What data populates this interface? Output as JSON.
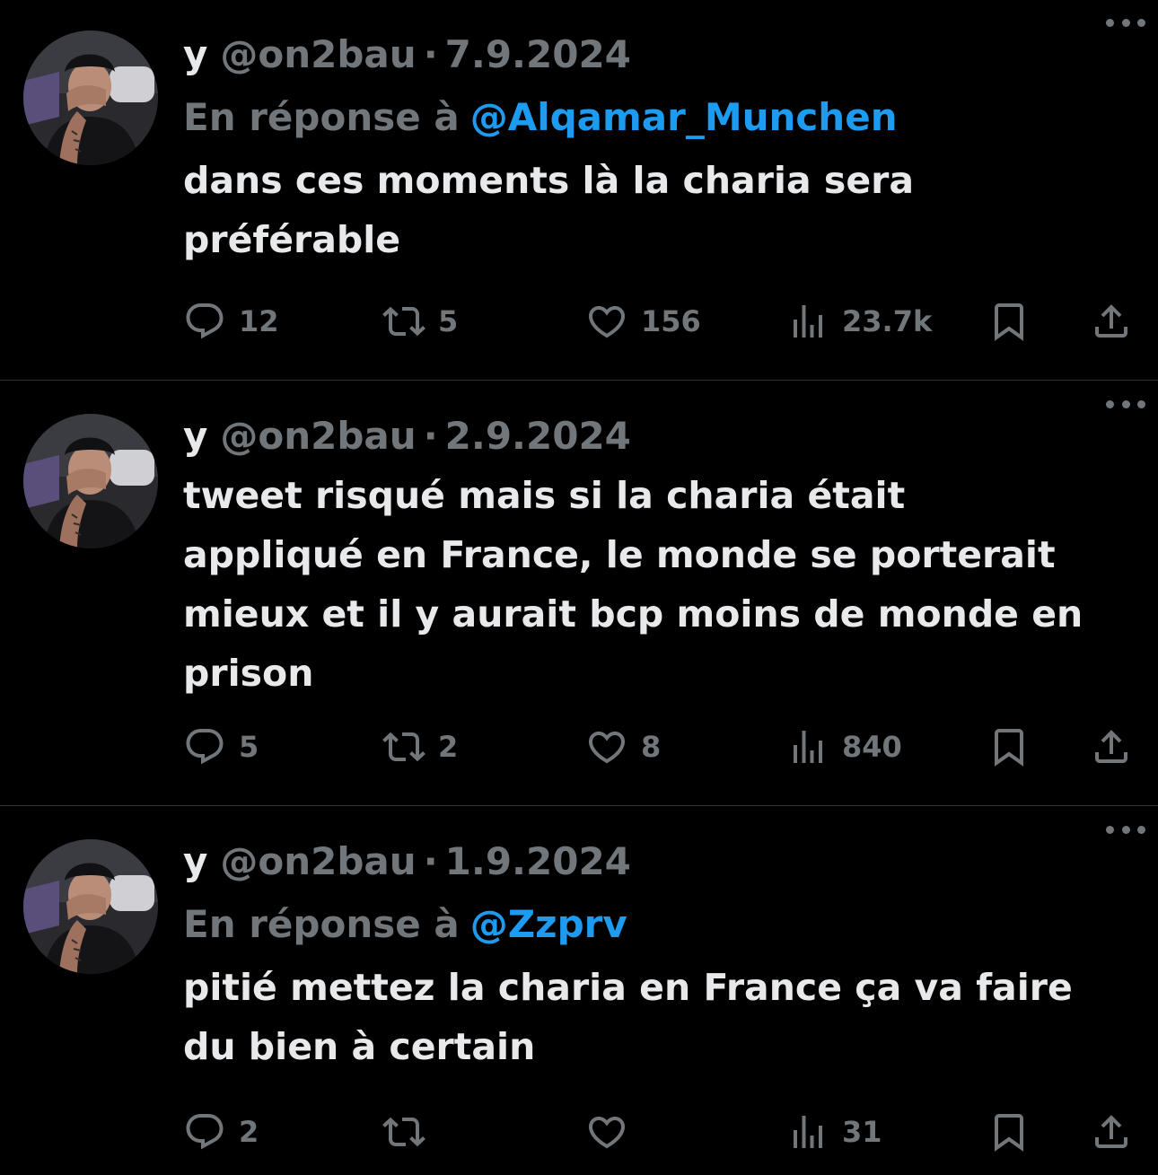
{
  "colors": {
    "background": "#000000",
    "text_primary": "#e7e9ea",
    "text_secondary": "#71767b",
    "link": "#1d9bf0",
    "divider": "#2f3336"
  },
  "tweets": [
    {
      "display_name": "y",
      "handle": "@on2bau",
      "separator": "·",
      "date": "7.9.2024",
      "reply_prefix": "En réponse à",
      "reply_to": "@Alqamar_Munchen",
      "text": "dans ces moments là la charia sera\npréférable",
      "replies": "12",
      "retweets": "5",
      "likes": "156",
      "views": "23.7k",
      "icons": [
        "reply-icon",
        "retweet-icon",
        "heart-icon",
        "views-icon",
        "bookmark-icon",
        "share-icon",
        "more-icon"
      ]
    },
    {
      "display_name": "y",
      "handle": "@on2bau",
      "separator": "·",
      "date": "2.9.2024",
      "text": "tweet risqué mais si la charia était\nappliqué en France, le monde se porterait\nmieux et il y aurait bcp moins de monde en\nprison",
      "replies": "5",
      "retweets": "2",
      "likes": "8",
      "views": "840",
      "icons": [
        "reply-icon",
        "retweet-icon",
        "heart-icon",
        "views-icon",
        "bookmark-icon",
        "share-icon",
        "more-icon"
      ]
    },
    {
      "display_name": "y",
      "handle": "@on2bau",
      "separator": "·",
      "date": "1.9.2024",
      "reply_prefix": "En réponse à",
      "reply_to": "@Zzprv",
      "text": "pitié mettez la charia en France ça va faire\ndu bien à certain",
      "replies": "2",
      "retweets": "",
      "likes": "",
      "views": "31",
      "icons": [
        "reply-icon",
        "retweet-icon",
        "heart-icon",
        "views-icon",
        "bookmark-icon",
        "share-icon",
        "more-icon"
      ]
    }
  ]
}
